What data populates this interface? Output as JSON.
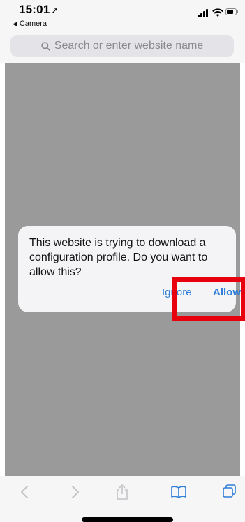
{
  "status_bar": {
    "time": "15:01",
    "location_arrow": "➚",
    "back_app": "Camera",
    "icons": [
      "signal-icon",
      "wifi-icon",
      "battery-icon"
    ]
  },
  "search": {
    "placeholder": "Search or enter website name",
    "icon": "search-icon"
  },
  "alert": {
    "message": "This website is trying to download a configuration profile. Do you want to allow this?",
    "ignore_label": "Ignore",
    "allow_label": "Allow"
  },
  "toolbar": {
    "icons": [
      "back-icon",
      "forward-icon",
      "share-icon",
      "bookmarks-icon",
      "tabs-icon"
    ]
  },
  "colors": {
    "accent": "#2f7fd8",
    "highlight": "#e8000f",
    "web_background": "#9a9a9a"
  }
}
